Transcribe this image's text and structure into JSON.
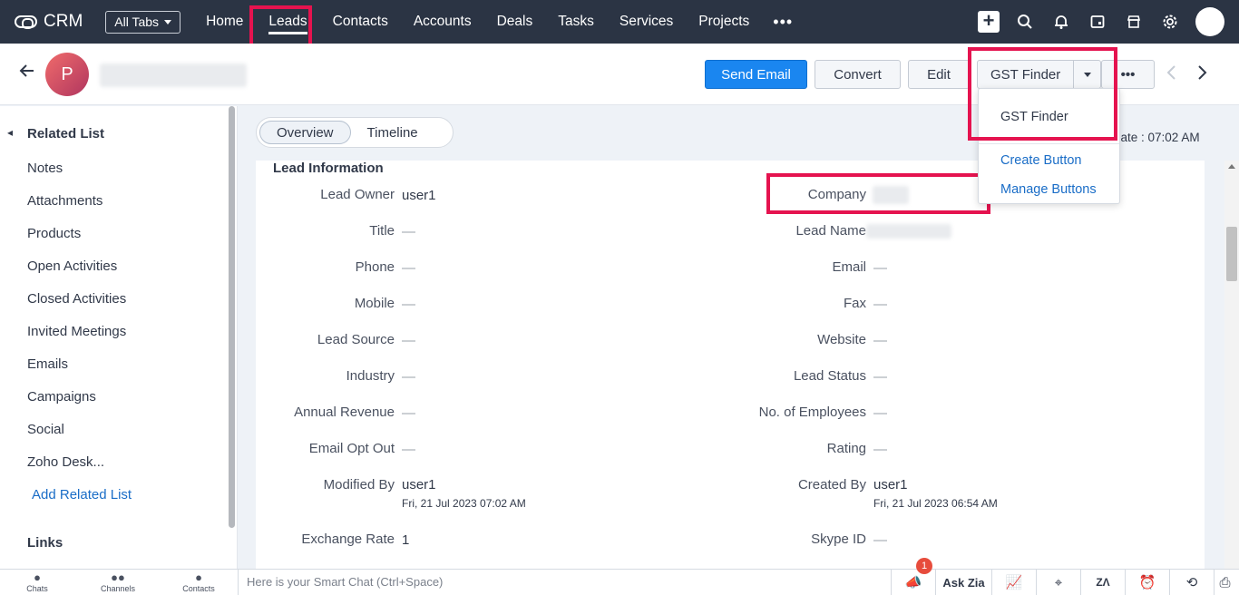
{
  "topnav": {
    "app_name": "CRM",
    "all_tabs_label": "All Tabs",
    "tabs": [
      {
        "label": "Home"
      },
      {
        "label": "Leads",
        "active": true
      },
      {
        "label": "Contacts"
      },
      {
        "label": "Accounts"
      },
      {
        "label": "Deals"
      },
      {
        "label": "Tasks"
      },
      {
        "label": "Services"
      },
      {
        "label": "Projects"
      }
    ],
    "more_label": "•••",
    "icons": [
      "plus-icon",
      "search-icon",
      "bell-icon",
      "calendar-icon",
      "store-icon",
      "gear-icon",
      "profile-avatar"
    ]
  },
  "record": {
    "avatar_letter": "P",
    "buttons": {
      "send_email": "Send Email",
      "convert": "Convert",
      "edit": "Edit",
      "gst_finder": "GST Finder",
      "more": "•••"
    }
  },
  "dropdown": {
    "item": "GST Finder",
    "create_button": "Create Button",
    "manage_buttons": "Manage Buttons"
  },
  "related_list": {
    "title": "Related List",
    "items": [
      "Notes",
      "Attachments",
      "Products",
      "Open Activities",
      "Closed Activities",
      "Invited Meetings",
      "Emails",
      "Campaigns",
      "Social",
      "Zoho Desk..."
    ],
    "add_label": "Add Related List",
    "links_title": "Links"
  },
  "main": {
    "tabs": [
      {
        "label": "Overview",
        "active": true
      },
      {
        "label": "Timeline"
      }
    ],
    "last_update": "date : 07:02 AM",
    "section_title": "Lead Information",
    "left_fields": [
      {
        "label": "Lead Owner",
        "value": "user1"
      },
      {
        "label": "Title",
        "value": "—"
      },
      {
        "label": "Phone",
        "value": "—"
      },
      {
        "label": "Mobile",
        "value": "—"
      },
      {
        "label": "Lead Source",
        "value": "—"
      },
      {
        "label": "Industry",
        "value": "—"
      },
      {
        "label": "Annual Revenue",
        "value": "—"
      },
      {
        "label": "Email Opt Out",
        "value": "—"
      },
      {
        "label": "Modified By",
        "value": "user1",
        "sub": "Fri, 21 Jul 2023 07:02 AM"
      },
      {
        "label": "Exchange Rate",
        "value": "1"
      }
    ],
    "right_fields": [
      {
        "label": "Company",
        "value": ""
      },
      {
        "label": "Lead Name",
        "value": ""
      },
      {
        "label": "Email",
        "value": "—"
      },
      {
        "label": "Fax",
        "value": "—"
      },
      {
        "label": "Website",
        "value": "—"
      },
      {
        "label": "Lead Status",
        "value": "—"
      },
      {
        "label": "No. of Employees",
        "value": "—"
      },
      {
        "label": "Rating",
        "value": "—"
      },
      {
        "label": "Created By",
        "value": "user1",
        "sub": "Fri, 21 Jul 2023 06:54 AM"
      },
      {
        "label": "Skype ID",
        "value": "—"
      }
    ]
  },
  "bottombar": {
    "items": [
      {
        "label": "Chats"
      },
      {
        "label": "Channels"
      },
      {
        "label": "Contacts"
      }
    ],
    "smart_chat_placeholder": "Here is your Smart Chat (Ctrl+Space)",
    "ask_zia": "Ask Zia",
    "notification_count": "1"
  },
  "colors": {
    "nav_bg": "#2b3444",
    "primary": "#1a86f0",
    "highlight": "#e5134f",
    "link": "#1a6dc7"
  }
}
